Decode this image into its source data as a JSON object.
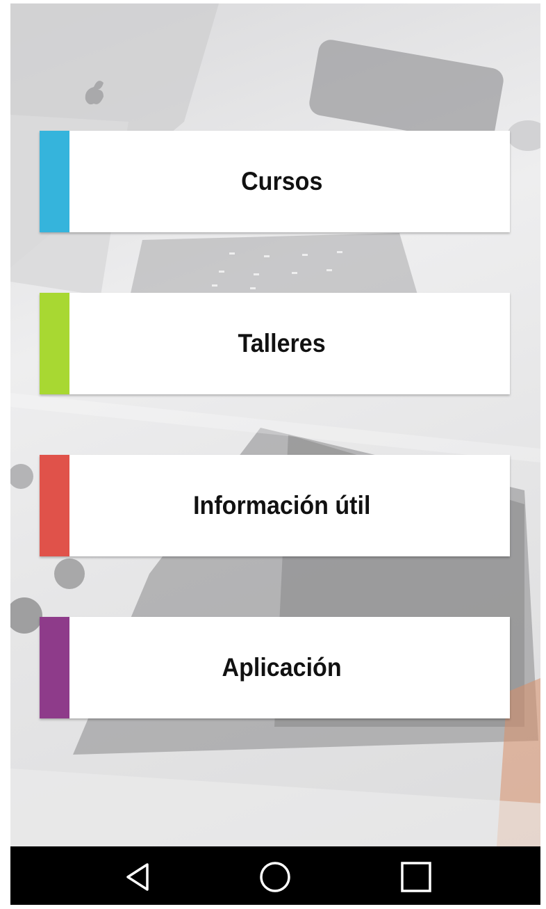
{
  "menu": {
    "items": [
      {
        "label": "Cursos",
        "color": "#35b4dc"
      },
      {
        "label": "Talleres",
        "color": "#a8d832"
      },
      {
        "label": "Información útil",
        "color": "#e0524a"
      },
      {
        "label": "Aplicación",
        "color": "#8e3b8a"
      }
    ]
  },
  "navbar": {
    "icons": [
      "back-triangle-icon",
      "home-circle-icon",
      "recents-square-icon"
    ]
  }
}
